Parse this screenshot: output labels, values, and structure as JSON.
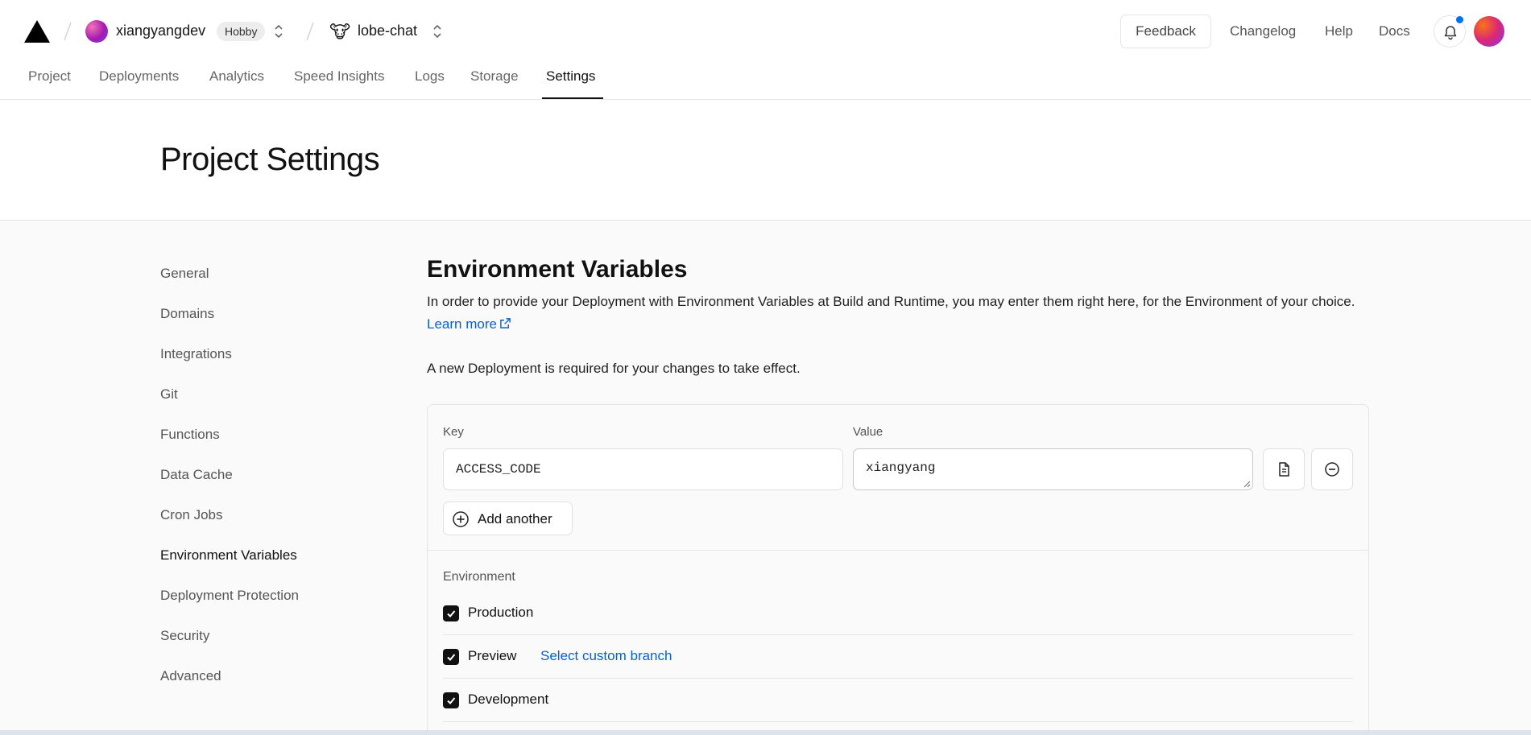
{
  "header": {
    "team_name": "xiangyangdev",
    "plan_badge": "Hobby",
    "project_emoji": "🐮",
    "project_name": "lobe-chat",
    "feedback_label": "Feedback",
    "links": [
      "Changelog",
      "Help",
      "Docs"
    ],
    "notification_dot_color": "#0070f3"
  },
  "tabs": [
    "Project",
    "Deployments",
    "Analytics",
    "Speed Insights",
    "Logs",
    "Storage",
    "Settings"
  ],
  "active_tab": "Settings",
  "page_title": "Project Settings",
  "sidebar": {
    "items": [
      "General",
      "Domains",
      "Integrations",
      "Git",
      "Functions",
      "Data Cache",
      "Cron Jobs",
      "Environment Variables",
      "Deployment Protection",
      "Security",
      "Advanced"
    ],
    "active": "Environment Variables"
  },
  "env": {
    "title": "Environment Variables",
    "description": "In order to provide your Deployment with Environment Variables at Build and Runtime, you may enter them right here, for the Environment of your choice.",
    "learn_more": "Learn more",
    "note": "A new Deployment is required for your changes to take effect.",
    "key_label": "Key",
    "value_label": "Value",
    "key_value": "ACCESS_CODE",
    "value_value": "xiangyang",
    "add_another": "Add another",
    "environment_label": "Environment",
    "environments": [
      {
        "label": "Production",
        "checked": true
      },
      {
        "label": "Preview",
        "checked": true
      },
      {
        "label": "Development",
        "checked": true
      }
    ],
    "custom_branch": "Select custom branch",
    "link_color": "#0761d1"
  }
}
